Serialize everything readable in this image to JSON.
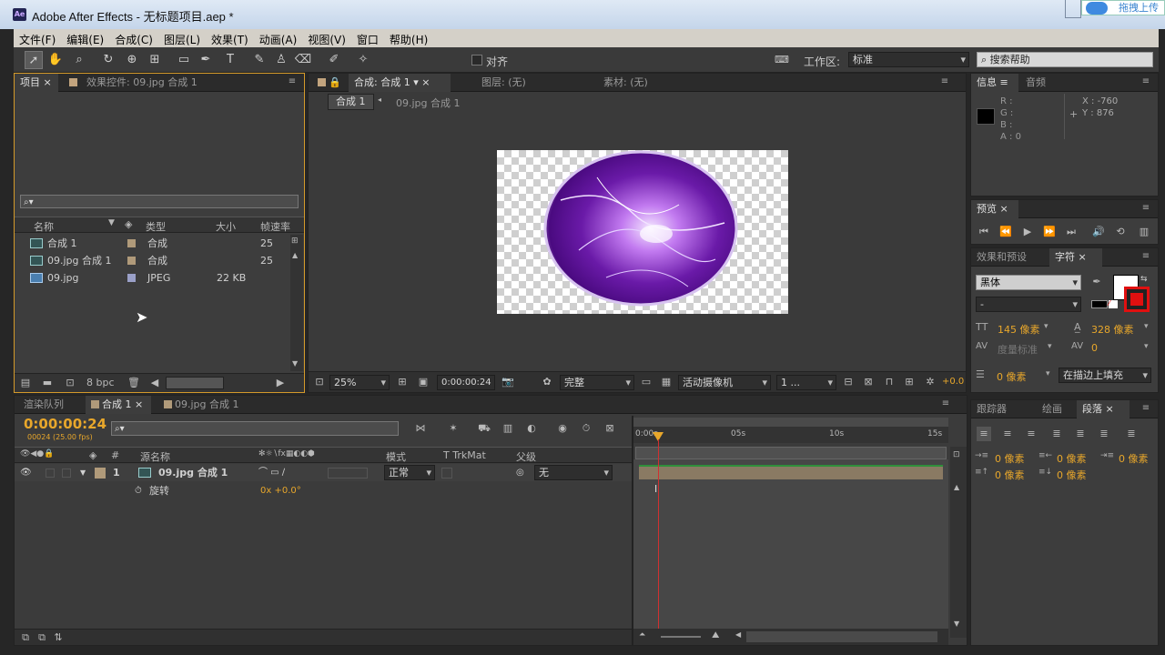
{
  "window": {
    "title": "Adobe After Effects - 无标题项目.aep *",
    "icon": "Ae",
    "upload_label": "拖拽上传"
  },
  "menu": [
    "文件(F)",
    "编辑(E)",
    "合成(C)",
    "图层(L)",
    "效果(T)",
    "动画(A)",
    "视图(V)",
    "窗口",
    "帮助(H)"
  ],
  "toolbar": {
    "snap_label": "对齐",
    "workspace_label": "工作区:",
    "workspace_value": "标准",
    "search_placeholder": "搜索帮助"
  },
  "project_panel": {
    "tabs": [
      "项目",
      "效果控件: 09.jpg 合成 1"
    ],
    "columns": [
      "名称",
      "类型",
      "大小",
      "帧速率"
    ],
    "items": [
      {
        "name": "合成 1",
        "type": "合成",
        "size": "",
        "fps": "25"
      },
      {
        "name": "09.jpg 合成 1",
        "type": "合成",
        "size": "",
        "fps": "25"
      },
      {
        "name": "09.jpg",
        "type": "JPEG",
        "size": "22 KB",
        "fps": ""
      }
    ],
    "bpc": "8 bpc"
  },
  "comp_panel": {
    "tabs": [
      "合成: 合成 1",
      "图层: (无)",
      "素材: (无)"
    ],
    "breadcrumb": [
      "合成 1",
      "09.jpg 合成 1"
    ],
    "zoom": "25%",
    "timecode": "0:00:00:24",
    "resolution": "完整",
    "camera": "活动摄像机",
    "views": "1 ...",
    "exposure": "+0.0"
  },
  "info_panel": {
    "tabs": [
      "信息",
      "音频"
    ],
    "r": "R :",
    "g": "G :",
    "b": "B :",
    "a": "A : 0",
    "x": "X : -760",
    "y": "Y : 876"
  },
  "preview_panel": {
    "tab": "预览"
  },
  "char_panel": {
    "tabs": [
      "效果和预设",
      "字符"
    ],
    "font": "黑体",
    "style": "-",
    "size": "145 像素",
    "leading": "328 像素",
    "kerning": "度量标准",
    "tracking": "0",
    "stroke": "0 像素",
    "stroke_mode": "在描边上填充"
  },
  "bottom_panel": {
    "tabs": [
      "跟踪器",
      "绘画",
      "段落"
    ],
    "indent_left": "0 像素",
    "indent_right": "0 像素",
    "indent_first": "0 像素",
    "space_before": "0 像素",
    "space_after": "0 像素"
  },
  "timeline": {
    "tabs": [
      "渲染队列",
      "合成 1",
      "09.jpg 合成 1"
    ],
    "timecode": "0:00:00:24",
    "frame_info": "00024 (25.00 fps)",
    "col_source": "源名称",
    "col_mode": "模式",
    "col_trk": "T  TrkMat",
    "col_parent": "父级",
    "layer": {
      "num": "1",
      "name": "09.jpg 合成 1",
      "mode": "正常",
      "parent": "无"
    },
    "prop": {
      "name": "旋转",
      "value": "0x +0.0°"
    },
    "ruler": [
      "0:00s",
      "05s",
      "10s",
      "15s"
    ]
  },
  "colors": {
    "accent": "#e8a72b",
    "panel": "#3d3d3d",
    "dark": "#262626",
    "playhead": "#d03030"
  }
}
